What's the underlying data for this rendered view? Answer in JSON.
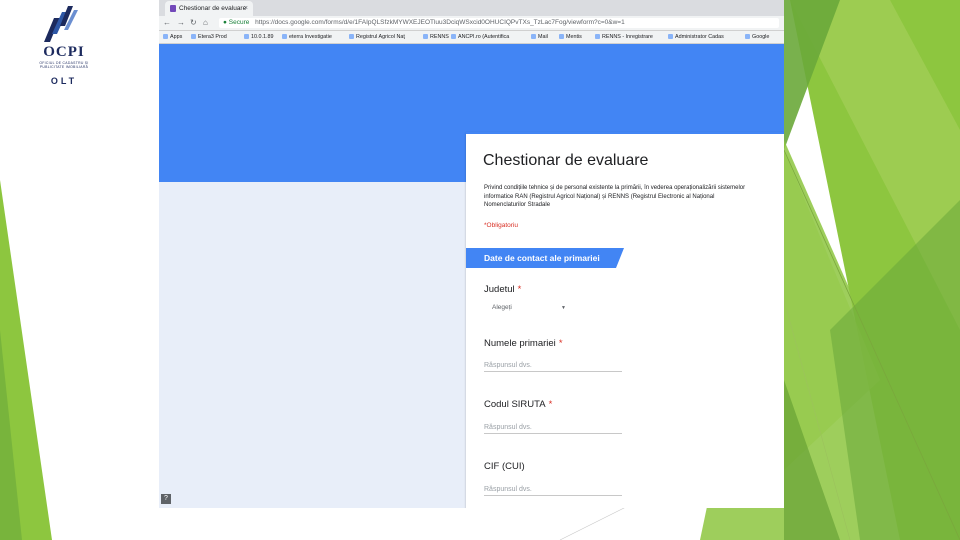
{
  "logo": {
    "title": "OCPI",
    "subtitle": "OFICIUL DE CADASTRU ȘI PUBLICITATE IMOBILIARĂ",
    "county": "OLT"
  },
  "browser": {
    "tab_title": "Chestionar de evaluare",
    "tab_close": "×",
    "security_label": "Secure",
    "url": "https://docs.google.com/forms/d/e/1FAIpQLSfzkMYWXEJEOTluu3DciqWSxcid0OHUCIQPvTXs_TzLac7Fog/viewform?c=0&w=1",
    "bookmarks": [
      "Apps",
      "Etera3 Prod",
      "10.0.1.89",
      "eterra Investigatie",
      "Registrul Agricol Naţ",
      "RENNS",
      "ANCPI.ro (Autentifica",
      "Mail",
      "Mentis",
      "RENNS - Inregistrare",
      "Administrator Cadas",
      "Google"
    ]
  },
  "form": {
    "title": "Chestionar de evaluare",
    "description": "Privind condițiile tehnice și de personal existente la primării, în vederea operaționalizării sistemelor informatice RAN (Registrul Agricol Național) și RENNS (Registrul Electronic al Național Nomenclaturilor Stradale",
    "required_note": "*Obligatoriu",
    "section_title": "Date de contact ale primariei",
    "questions": [
      {
        "label": "Judetul",
        "required": "*",
        "type": "select",
        "value": "Alegeți"
      },
      {
        "label": "Numele primariei",
        "required": "*",
        "type": "text",
        "placeholder": "Răspunsul dvs."
      },
      {
        "label": "Codul SIRUTA",
        "required": "*",
        "type": "text",
        "placeholder": "Răspunsul dvs."
      },
      {
        "label": "CIF (CUI)",
        "required": "",
        "type": "text",
        "placeholder": "Răspunsul dvs."
      }
    ]
  },
  "help_icon": "?",
  "colors": {
    "accent_blue": "#4285f4",
    "green_dark": "#5f9b2f",
    "green_light": "#8dc63f",
    "page_bg": "#e8eef9"
  }
}
